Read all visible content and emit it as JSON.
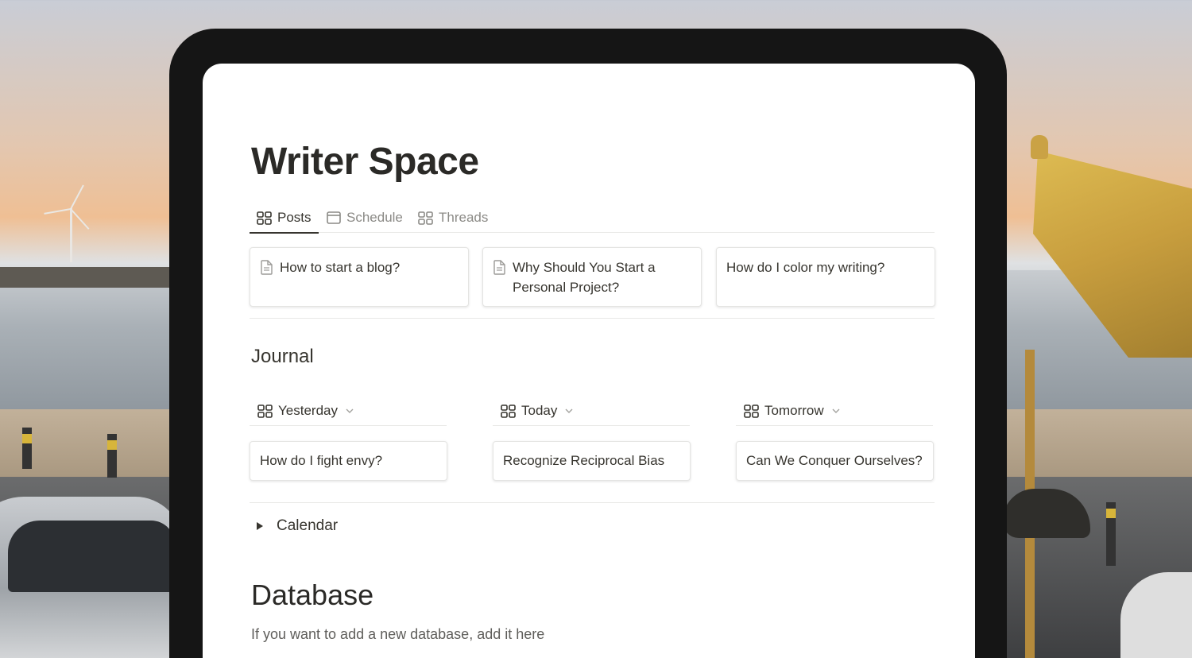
{
  "page": {
    "title": "Writer Space",
    "tabs": [
      {
        "label": "Posts",
        "icon": "gallery-icon",
        "active": true
      },
      {
        "label": "Schedule",
        "icon": "calendar-icon",
        "active": false
      },
      {
        "label": "Threads",
        "icon": "gallery-icon",
        "active": false
      }
    ],
    "posts": [
      {
        "title": "How to start a blog?",
        "icon": "document-icon"
      },
      {
        "title": "Why Should You Start a Personal Project?",
        "icon": "document-icon"
      },
      {
        "title": "How do I color my writing?",
        "icon": null
      }
    ],
    "journal": {
      "heading": "Journal",
      "columns": [
        {
          "label": "Yesterday",
          "card": "How do I fight envy?"
        },
        {
          "label": "Today",
          "card": "Recognize Reciprocal Bias"
        },
        {
          "label": "Tomorrow",
          "card": "Can We Conquer Ourselves?"
        }
      ]
    },
    "calendar_toggle": "Calendar",
    "database": {
      "heading": "Database",
      "text": "If you want to add a new database, add it here"
    }
  },
  "colors": {
    "text": "#37352f",
    "muted": "#8b8a86",
    "border": "#e9e9e7",
    "tablet_bezel": "#151515"
  }
}
